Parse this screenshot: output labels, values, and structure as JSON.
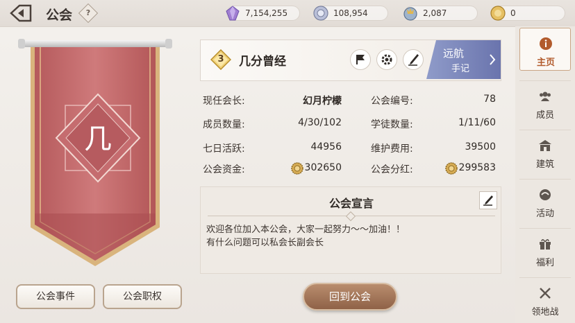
{
  "header": {
    "title": "公会",
    "help_label": "?",
    "resources": [
      {
        "icon": "purple-crystal-icon",
        "value": "7,154,255"
      },
      {
        "icon": "silver-medal-icon",
        "value": "108,954"
      },
      {
        "icon": "guild-token-icon",
        "value": "2,087"
      },
      {
        "icon": "gold-coin-icon",
        "value": "0"
      }
    ]
  },
  "banner": {
    "emblem_char": "几"
  },
  "guild": {
    "level": "3",
    "name": "几分曾经",
    "voyage_line1": "远航",
    "voyage_line2": "手记"
  },
  "stats": {
    "leader_label": "现任会长:",
    "leader_value": "幻月柠檬",
    "id_label": "公会编号:",
    "id_value": "78",
    "members_label": "成员数量:",
    "members_value": "4/30/102",
    "scholars_label": "学徒数量:",
    "scholars_value": "1/11/60",
    "active_label": "七日活跃:",
    "active_value": "44956",
    "upkeep_label": "维护费用:",
    "upkeep_value": "39500",
    "funds_label": "公会资金:",
    "funds_value": "302650",
    "dividend_label": "公会分红:",
    "dividend_value": "299583"
  },
  "declaration": {
    "title": "公会宣言",
    "line1": "欢迎各位加入本公会，大家一起努力～～加油！！",
    "line2": "有什么问题可以私会长副会长"
  },
  "buttons": {
    "events": "公会事件",
    "permissions": "公会职权",
    "return": "回到公会"
  },
  "sidenav": [
    {
      "label": "主页",
      "icon": "info-icon",
      "active": true
    },
    {
      "label": "成员",
      "icon": "members-icon",
      "active": false
    },
    {
      "label": "建筑",
      "icon": "building-icon",
      "active": false
    },
    {
      "label": "活动",
      "icon": "activity-icon",
      "active": false
    },
    {
      "label": "福利",
      "icon": "gift-icon",
      "active": false
    },
    {
      "label": "领地战",
      "icon": "crossed-swords-icon",
      "active": false
    }
  ],
  "colors": {
    "accent": "#b25b2c",
    "banner": "#c97172",
    "gold": "#d6b27a"
  }
}
